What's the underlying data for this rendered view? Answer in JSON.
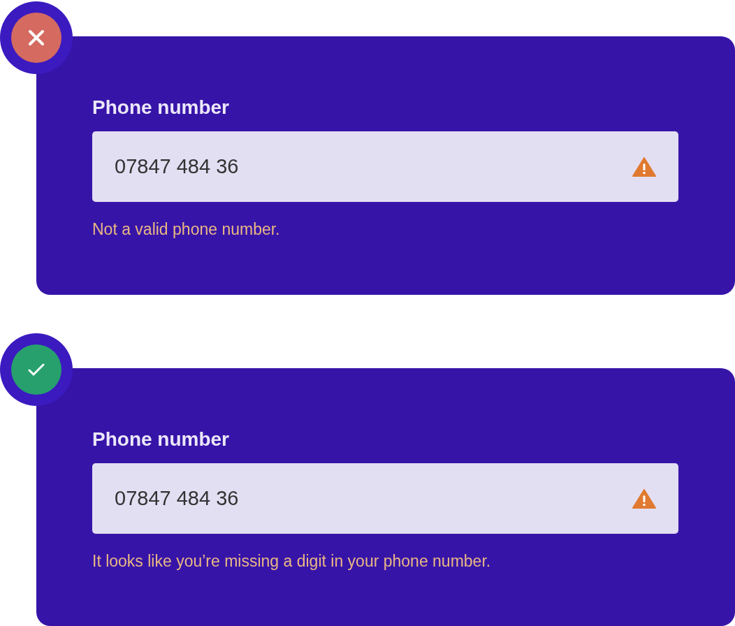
{
  "examples": [
    {
      "kind": "wrong",
      "label": "Phone number",
      "value": "07847 484 36",
      "message": "Not a valid phone number."
    },
    {
      "kind": "right",
      "label": "Phone number",
      "value": "07847 484 36",
      "message": "It looks like you’re missing a digit in your phone number."
    }
  ]
}
